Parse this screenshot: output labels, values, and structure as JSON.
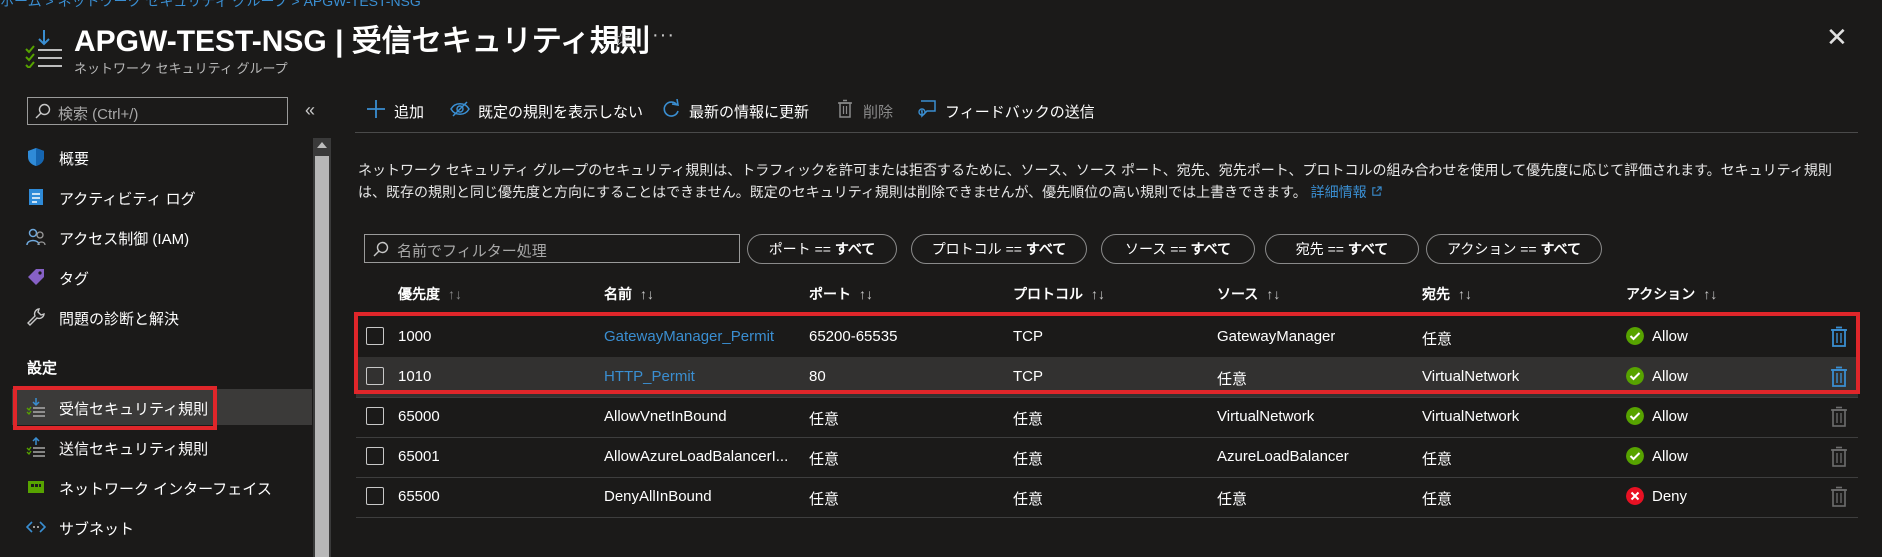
{
  "breadcrumb": "ホーム > ネットワーク セキュリティ グループ > APGW-TEST-NSG",
  "header": {
    "title": "APGW-TEST-NSG | 受信セキュリティ規則",
    "subtitle": "ネットワーク セキュリティ グループ",
    "star": "☆",
    "more": "···",
    "close": "✕"
  },
  "sidebar": {
    "search_placeholder": "検索 (Ctrl+/)",
    "collapse": "«",
    "items": [
      {
        "label": "概要",
        "icon": "shield-icon"
      },
      {
        "label": "アクティビティ ログ",
        "icon": "activity-log-icon"
      },
      {
        "label": "アクセス制御 (IAM)",
        "icon": "iam-people-icon"
      },
      {
        "label": "タグ",
        "icon": "tag-icon"
      },
      {
        "label": "問題の診断と解決",
        "icon": "wrench-icon"
      }
    ],
    "section_label": "設定",
    "settings_items": [
      {
        "label": "受信セキュリティ規則",
        "icon": "inbound-rules-icon",
        "active": true
      },
      {
        "label": "送信セキュリティ規則",
        "icon": "outbound-rules-icon"
      },
      {
        "label": "ネットワーク インターフェイス",
        "icon": "network-interface-icon"
      },
      {
        "label": "サブネット",
        "icon": "subnet-icon"
      }
    ]
  },
  "toolbar": {
    "add": "追加",
    "hide_default": "既定の規則を表示しない",
    "refresh": "最新の情報に更新",
    "delete": "削除",
    "feedback": "フィードバックの送信"
  },
  "description": {
    "text": "ネットワーク セキュリティ グループのセキュリティ規則は、トラフィックを許可または拒否するために、ソース、ソース ポート、宛先、宛先ポート、プロトコルの組み合わせを使用して優先度に応じて評価されます。セキュリティ規則は、既存の規則と同じ優先度と方向にすることはできません。既定のセキュリティ規則は削除できませんが、優先順位の高い規則では上書きできます。",
    "link": "詳細情報"
  },
  "filters": {
    "name_placeholder": "名前でフィルター処理",
    "pills": [
      {
        "key": "ポート == ",
        "value": "すべて"
      },
      {
        "key": "プロトコル == ",
        "value": "すべて"
      },
      {
        "key": "ソース == ",
        "value": "すべて"
      },
      {
        "key": "宛先 == ",
        "value": "すべて"
      },
      {
        "key": "アクション == ",
        "value": "すべて"
      }
    ]
  },
  "table": {
    "sort_glyph": "↑↓",
    "columns": [
      "優先度",
      "名前",
      "ポート",
      "プロトコル",
      "ソース",
      "宛先",
      "アクション"
    ],
    "rows": [
      {
        "priority": "1000",
        "name": "GatewayManager_Permit",
        "port": "65200-65535",
        "protocol": "TCP",
        "source": "GatewayManager",
        "destination": "任意",
        "action": "Allow",
        "custom": true,
        "selected": false
      },
      {
        "priority": "1010",
        "name": "HTTP_Permit",
        "port": "80",
        "protocol": "TCP",
        "source": "任意",
        "destination": "VirtualNetwork",
        "action": "Allow",
        "custom": true,
        "selected": true
      },
      {
        "priority": "65000",
        "name": "AllowVnetInBound",
        "port": "任意",
        "protocol": "任意",
        "source": "VirtualNetwork",
        "destination": "VirtualNetwork",
        "action": "Allow",
        "custom": false,
        "selected": false
      },
      {
        "priority": "65001",
        "name": "AllowAzureLoadBalancerI...",
        "port": "任意",
        "protocol": "任意",
        "source": "AzureLoadBalancer",
        "destination": "任意",
        "action": "Allow",
        "custom": false,
        "selected": false
      },
      {
        "priority": "65500",
        "name": "DenyAllInBound",
        "port": "任意",
        "protocol": "任意",
        "source": "任意",
        "destination": "任意",
        "action": "Deny",
        "custom": false,
        "selected": false
      }
    ]
  },
  "colors": {
    "background": "#1b1a19",
    "link": "#3a8ed1",
    "highlight": "#e0262a",
    "allow": "#57a300",
    "deny": "#e81123",
    "delete_enabled": "#3a8ed1",
    "delete_disabled": "#6e6e6e"
  }
}
